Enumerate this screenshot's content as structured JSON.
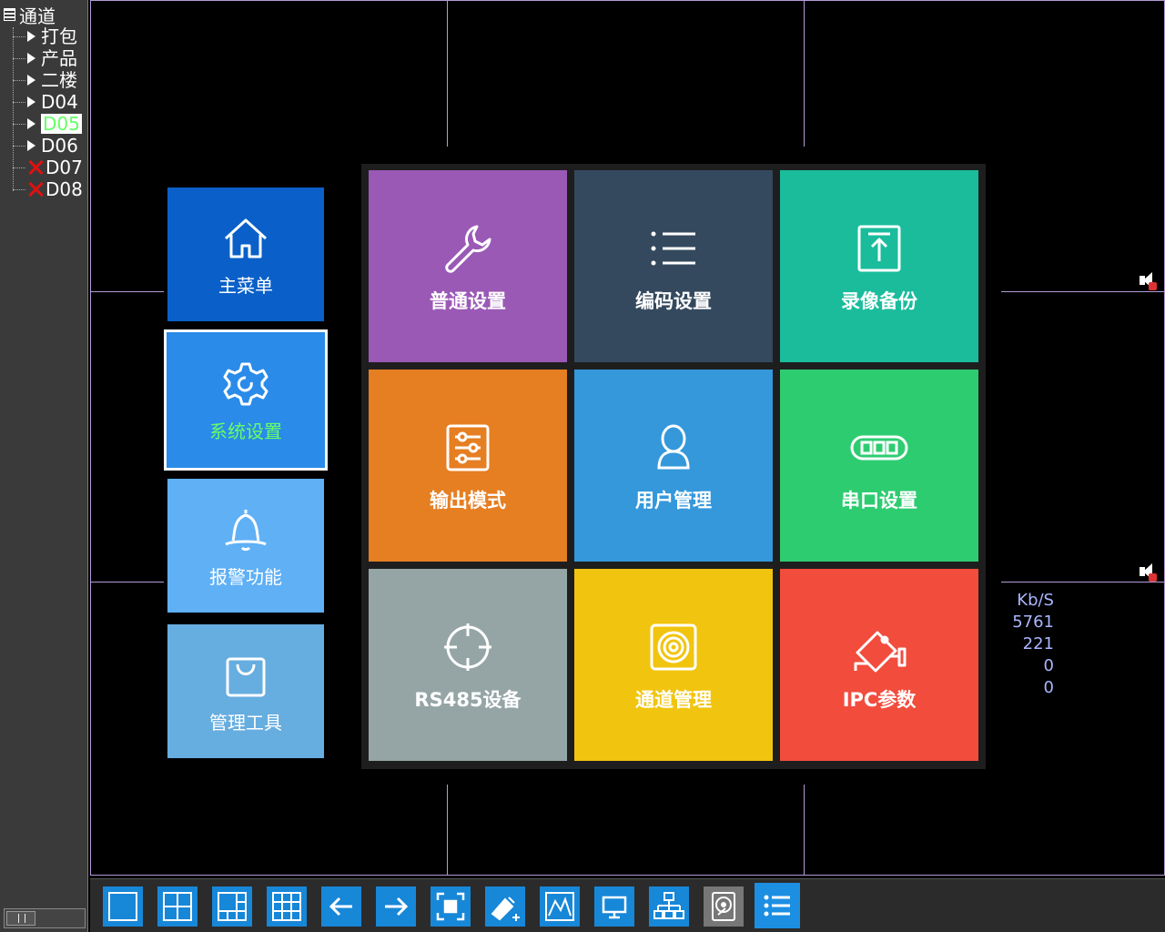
{
  "sidebar": {
    "root_label": "通道",
    "items": [
      {
        "label": "打包",
        "status": "ok"
      },
      {
        "label": "产品",
        "status": "ok"
      },
      {
        "label": "二楼",
        "status": "ok"
      },
      {
        "label": "D04",
        "status": "ok"
      },
      {
        "label": "D05",
        "status": "selected"
      },
      {
        "label": "D06",
        "status": "ok"
      },
      {
        "label": "D07",
        "status": "offline"
      },
      {
        "label": "D08",
        "status": "offline"
      }
    ]
  },
  "stats": {
    "unit": "Kb/S",
    "values": [
      "5761",
      "221",
      "0",
      "0"
    ]
  },
  "main_menu": {
    "categories": [
      {
        "label": "主菜单",
        "icon": "home-icon"
      },
      {
        "label": "系统设置",
        "icon": "gear-icon",
        "selected": true
      },
      {
        "label": "报警功能",
        "icon": "bell-icon"
      },
      {
        "label": "管理工具",
        "icon": "bag-icon"
      }
    ],
    "tiles": [
      {
        "label": "普通设置",
        "icon": "wrench-icon",
        "color": "#9b59b6"
      },
      {
        "label": "编码设置",
        "icon": "list-icon",
        "color": "#34495e"
      },
      {
        "label": "录像备份",
        "icon": "upload-icon",
        "color": "#1abc9c"
      },
      {
        "label": "输出模式",
        "icon": "sliders-icon",
        "color": "#e67e22"
      },
      {
        "label": "用户管理",
        "icon": "user-icon",
        "color": "#3498db"
      },
      {
        "label": "串口设置",
        "icon": "serial-port-icon",
        "color": "#2ecc71"
      },
      {
        "label": "RS485设备",
        "icon": "crosshair-icon",
        "color": "#95a5a6"
      },
      {
        "label": "通道管理",
        "icon": "speaker-icon",
        "color": "#f1c40f"
      },
      {
        "label": "IPC参数",
        "icon": "cctv-camera-icon",
        "color": "#f24c3d"
      }
    ]
  },
  "toolbar": {
    "buttons": [
      {
        "icon": "single-view-icon"
      },
      {
        "icon": "quad-view-icon"
      },
      {
        "icon": "six-view-icon"
      },
      {
        "icon": "nine-view-icon"
      },
      {
        "icon": "arrow-left-icon"
      },
      {
        "icon": "arrow-right-icon"
      },
      {
        "icon": "fullscreen-icon"
      },
      {
        "icon": "ptz-icon"
      },
      {
        "icon": "chart-icon"
      },
      {
        "icon": "monitor-icon"
      },
      {
        "icon": "network-icon"
      },
      {
        "icon": "hard-disk-icon"
      },
      {
        "icon": "menu-icon"
      }
    ]
  },
  "colors": {
    "grid_line": "#b49bd8",
    "selected_text": "#66ff66",
    "offline_mark": "#e01010",
    "stats_text": "#aab6ff"
  }
}
